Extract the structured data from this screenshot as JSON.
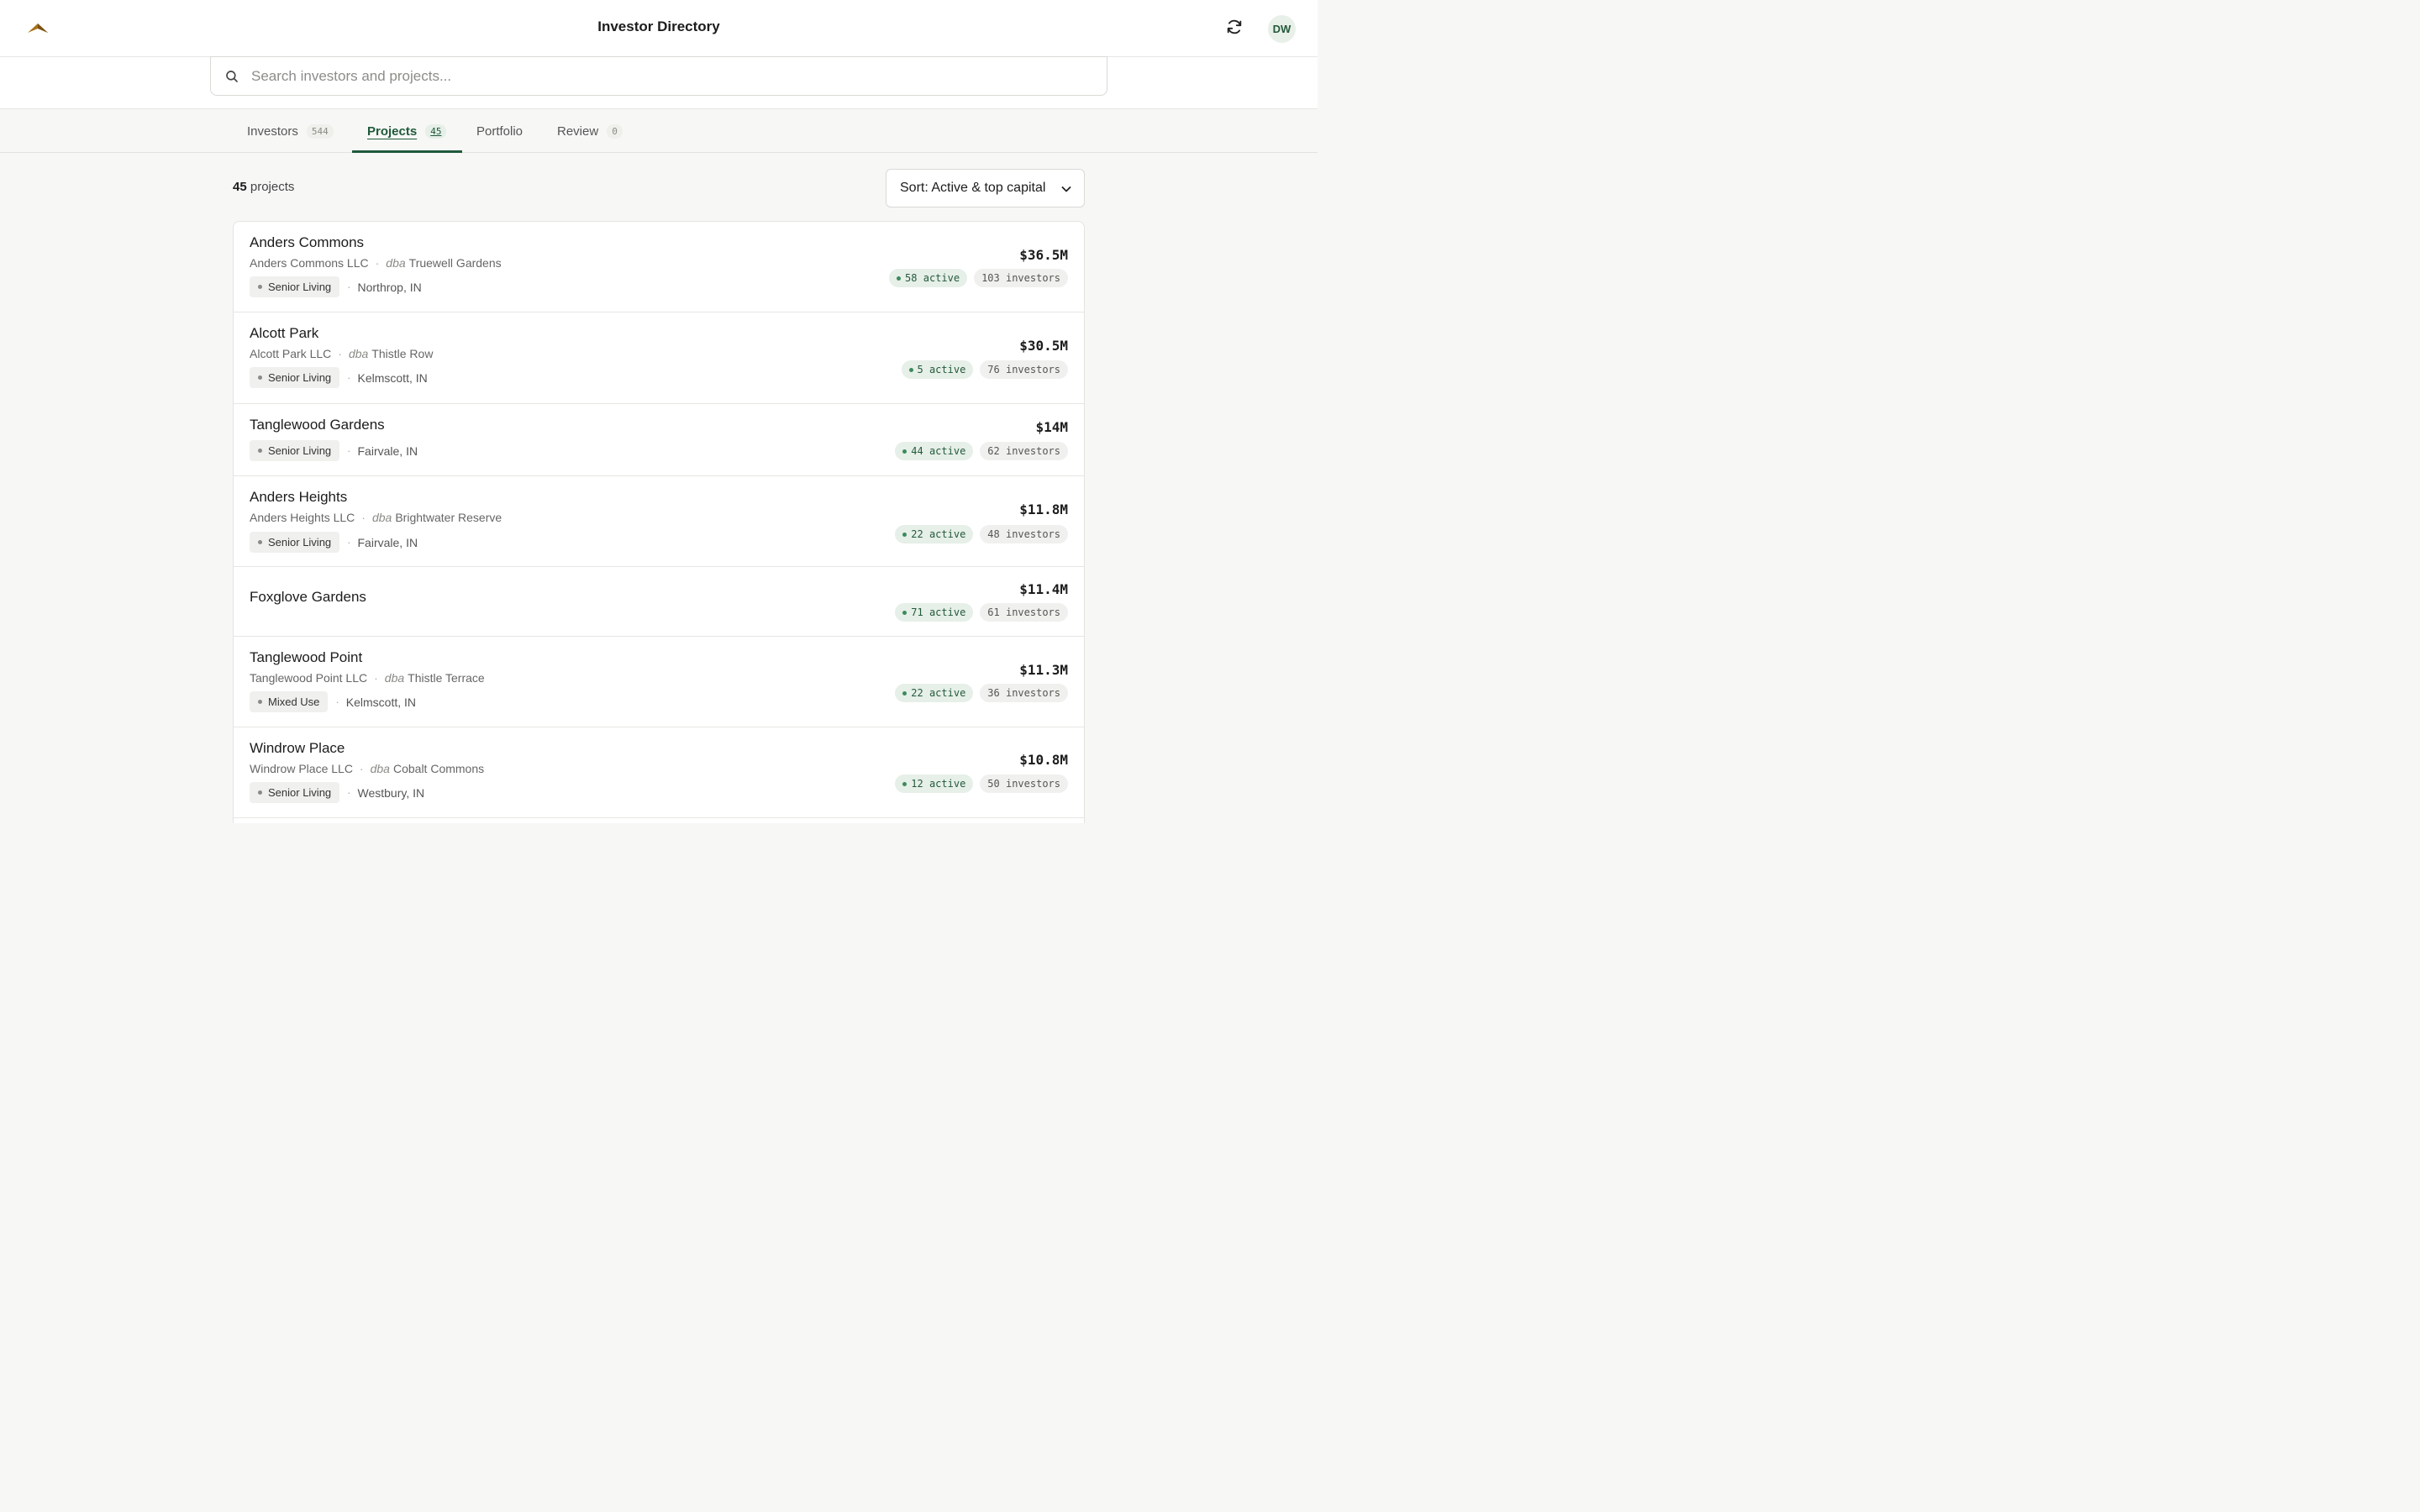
{
  "header": {
    "title": "Investor Directory",
    "avatar_initials": "DW",
    "logo_icon": "mountain-logo-icon",
    "refresh_icon": "refresh-icon",
    "brand_color": "#a9711c"
  },
  "search": {
    "placeholder": "Search investors and projects...",
    "value": ""
  },
  "tabs": [
    {
      "label": "Investors",
      "count": "544",
      "active": false
    },
    {
      "label": "Projects",
      "count": "45",
      "active": true
    },
    {
      "label": "Portfolio",
      "count": "",
      "active": false
    },
    {
      "label": "Review",
      "count": "0",
      "active": false
    }
  ],
  "results": {
    "count": "45",
    "count_suffix": "projects",
    "sort_label": "Sort: Active & top capital"
  },
  "projects": [
    {
      "name": "Anders Commons",
      "legal": "Anders Commons LLC",
      "dba_label": "dba",
      "dba": "Truewell Gardens",
      "type": "Senior Living",
      "location": "Northrop, IN",
      "amount": "$36.5M",
      "active": "58 active",
      "investors": "103 investors"
    },
    {
      "name": "Alcott Park",
      "legal": "Alcott Park LLC",
      "dba_label": "dba",
      "dba": "Thistle Row",
      "type": "Senior Living",
      "location": "Kelmscott, IN",
      "amount": "$30.5M",
      "active": "5 active",
      "investors": "76 investors"
    },
    {
      "name": "Tanglewood Gardens",
      "legal": "",
      "dba_label": "",
      "dba": "",
      "type": "Senior Living",
      "location": "Fairvale, IN",
      "amount": "$14M",
      "active": "44 active",
      "investors": "62 investors"
    },
    {
      "name": "Anders Heights",
      "legal": "Anders Heights LLC",
      "dba_label": "dba",
      "dba": "Brightwater Reserve",
      "type": "Senior Living",
      "location": "Fairvale, IN",
      "amount": "$11.8M",
      "active": "22 active",
      "investors": "48 investors"
    },
    {
      "name": "Foxglove Gardens",
      "legal": "",
      "dba_label": "",
      "dba": "",
      "type": "",
      "location": "",
      "amount": "$11.4M",
      "active": "71 active",
      "investors": "61 investors"
    },
    {
      "name": "Tanglewood Point",
      "legal": "Tanglewood Point LLC",
      "dba_label": "dba",
      "dba": "Thistle Terrace",
      "type": "Mixed Use",
      "location": "Kelmscott, IN",
      "amount": "$11.3M",
      "active": "22 active",
      "investors": "36 investors"
    },
    {
      "name": "Windrow Place",
      "legal": "Windrow Place LLC",
      "dba_label": "dba",
      "dba": "Cobalt Commons",
      "type": "Senior Living",
      "location": "Westbury, IN",
      "amount": "$10.8M",
      "active": "12 active",
      "investors": "50 investors"
    }
  ]
}
